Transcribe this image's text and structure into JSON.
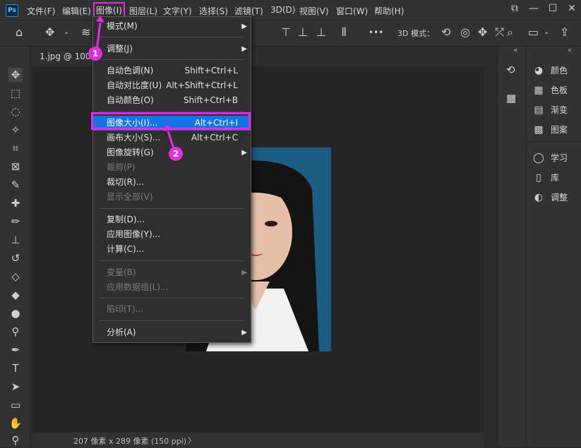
{
  "app": {
    "logo": "Ps"
  },
  "menubar": {
    "items": [
      "文件(F)",
      "编辑(E)",
      "图像(I)",
      "图层(L)",
      "文字(Y)",
      "选择(S)",
      "滤镜(T)",
      "3D(D)",
      "视图(V)",
      "窗口(W)",
      "帮助(H)"
    ],
    "window_buttons": [
      "⧉",
      "—",
      "☐",
      "✕"
    ]
  },
  "options_bar": {
    "mode_3d_label": "3D 模式：",
    "more": "•••"
  },
  "document": {
    "tab_label": "1.jpg @ 100%",
    "status": "207 像素 x 289 像素 (150 ppi)",
    "status_arrow": "〉"
  },
  "dropdown": {
    "items": [
      {
        "label": "模式(M)",
        "submenu": true,
        "disabled": false
      },
      {
        "label": "调整(J)",
        "submenu": true,
        "disabled": false
      },
      {
        "label": "自动色调(N)",
        "shortcut": "Shift+Ctrl+L",
        "disabled": false
      },
      {
        "label": "自动对比度(U)",
        "shortcut": "Alt+Shift+Ctrl+L",
        "disabled": false
      },
      {
        "label": "自动颜色(O)",
        "shortcut": "Shift+Ctrl+B",
        "disabled": false
      },
      {
        "label": "图像大小(I)...",
        "shortcut": "Alt+Ctrl+I",
        "disabled": false,
        "highlighted": true
      },
      {
        "label": "画布大小(S)...",
        "shortcut": "Alt+Ctrl+C",
        "disabled": false
      },
      {
        "label": "图像旋转(G)",
        "submenu": true,
        "disabled": false
      },
      {
        "label": "裁剪(P)",
        "disabled": true
      },
      {
        "label": "裁切(R)...",
        "disabled": false
      },
      {
        "label": "显示全部(V)",
        "disabled": true
      },
      {
        "label": "复制(D)...",
        "disabled": false
      },
      {
        "label": "应用图像(Y)...",
        "disabled": false
      },
      {
        "label": "计算(C)...",
        "disabled": false
      },
      {
        "label": "变量(B)",
        "submenu": true,
        "disabled": true
      },
      {
        "label": "应用数据组(L)...",
        "disabled": true
      },
      {
        "label": "陷印(T)...",
        "disabled": true
      },
      {
        "label": "分析(A)",
        "submenu": true,
        "disabled": false
      }
    ]
  },
  "annotations": {
    "badge1": "1",
    "badge2": "2",
    "accent": "#e32de3"
  },
  "right_panels": {
    "panel_a": [
      {
        "icon": "history-icon",
        "label": "颜色"
      },
      {
        "icon": "swatches-icon",
        "label": "色板"
      },
      {
        "icon": "gradient-icon",
        "label": "渐变"
      },
      {
        "icon": "pattern-icon",
        "label": "图案"
      },
      {
        "icon": "learn-icon",
        "label": "学习"
      },
      {
        "icon": "library-icon",
        "label": "库"
      },
      {
        "icon": "adjust-icon",
        "label": "调整"
      }
    ]
  }
}
